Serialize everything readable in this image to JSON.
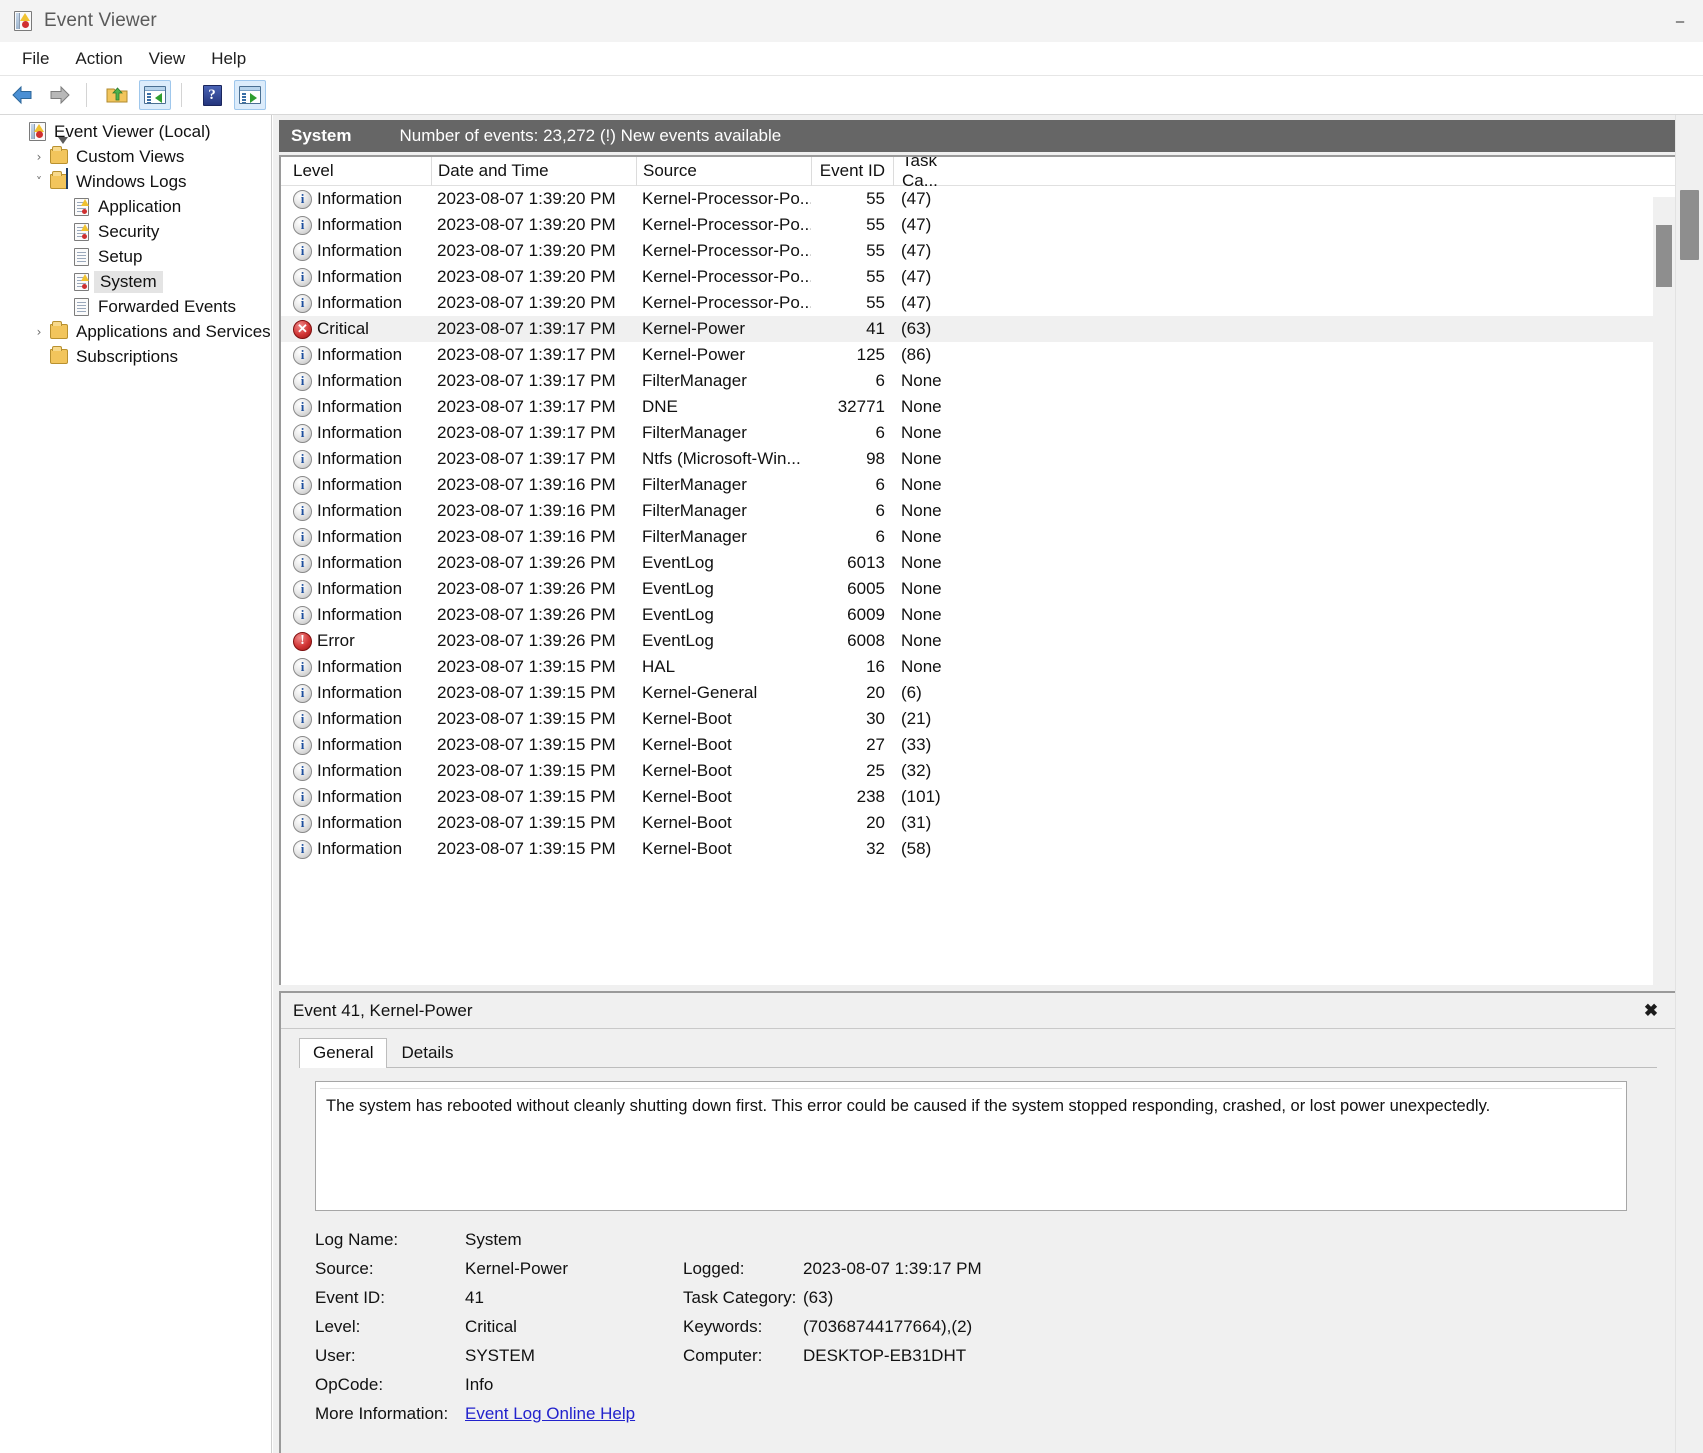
{
  "window": {
    "title": "Event Viewer",
    "icon": "event-viewer-icon",
    "controls": {
      "minimize": "–",
      "maximize": "□",
      "close": "✕"
    }
  },
  "menu": {
    "items": [
      "File",
      "Action",
      "View",
      "Help"
    ]
  },
  "toolbar": {
    "buttons": [
      {
        "name": "back-button",
        "icon": "arrow-left-icon"
      },
      {
        "name": "forward-button",
        "icon": "arrow-right-icon"
      },
      {
        "name": "up-one-level-button",
        "icon": "folder-up-icon"
      },
      {
        "name": "show-hide-console-tree-button",
        "icon": "console-tree-icon",
        "selected": true
      },
      {
        "name": "help-button",
        "icon": "help-question-icon"
      },
      {
        "name": "show-hide-action-pane-button",
        "icon": "action-pane-icon",
        "selected": true
      }
    ]
  },
  "sidebar": {
    "nodes": [
      {
        "label": "Event Viewer (Local)",
        "indent": 0,
        "chevron": "",
        "icon": "event-viewer-icon",
        "selected": false
      },
      {
        "label": "Custom Views",
        "indent": 1,
        "chevron": "›",
        "icon": "folder-filter-icon",
        "selected": false
      },
      {
        "label": "Windows Logs",
        "indent": 1,
        "chevron": "˅",
        "icon": "folder-monitor-icon",
        "selected": false
      },
      {
        "label": "Application",
        "indent": 2,
        "chevron": "",
        "icon": "log-warning-icon",
        "selected": false
      },
      {
        "label": "Security",
        "indent": 2,
        "chevron": "",
        "icon": "log-warning-icon",
        "selected": false
      },
      {
        "label": "Setup",
        "indent": 2,
        "chevron": "",
        "icon": "log-icon",
        "selected": false
      },
      {
        "label": "System",
        "indent": 2,
        "chevron": "",
        "icon": "log-warning-icon",
        "selected": true
      },
      {
        "label": "Forwarded Events",
        "indent": 2,
        "chevron": "",
        "icon": "log-icon",
        "selected": false
      },
      {
        "label": "Applications and Services Log",
        "indent": 1,
        "chevron": "›",
        "icon": "folder-icon",
        "selected": false
      },
      {
        "label": "Subscriptions",
        "indent": 1,
        "chevron": "",
        "icon": "folder-subscription-icon",
        "selected": false
      }
    ]
  },
  "log_header": {
    "name": "System",
    "count_text": "Number of events: 23,272 (!) New events available"
  },
  "table": {
    "columns": [
      "Level",
      "Date and Time",
      "Source",
      "Event ID",
      "Task Ca..."
    ],
    "rows": [
      {
        "level": "Information",
        "level_icon": "info-icon",
        "date": "2023-08-07 1:39:20 PM",
        "source": "Kernel-Processor-Po...",
        "event_id": "55",
        "task": "(47)",
        "selected": false
      },
      {
        "level": "Information",
        "level_icon": "info-icon",
        "date": "2023-08-07 1:39:20 PM",
        "source": "Kernel-Processor-Po...",
        "event_id": "55",
        "task": "(47)",
        "selected": false
      },
      {
        "level": "Information",
        "level_icon": "info-icon",
        "date": "2023-08-07 1:39:20 PM",
        "source": "Kernel-Processor-Po...",
        "event_id": "55",
        "task": "(47)",
        "selected": false
      },
      {
        "level": "Information",
        "level_icon": "info-icon",
        "date": "2023-08-07 1:39:20 PM",
        "source": "Kernel-Processor-Po...",
        "event_id": "55",
        "task": "(47)",
        "selected": false
      },
      {
        "level": "Information",
        "level_icon": "info-icon",
        "date": "2023-08-07 1:39:20 PM",
        "source": "Kernel-Processor-Po...",
        "event_id": "55",
        "task": "(47)",
        "selected": false
      },
      {
        "level": "Critical",
        "level_icon": "critical-icon",
        "date": "2023-08-07 1:39:17 PM",
        "source": "Kernel-Power",
        "event_id": "41",
        "task": "(63)",
        "selected": true
      },
      {
        "level": "Information",
        "level_icon": "info-icon",
        "date": "2023-08-07 1:39:17 PM",
        "source": "Kernel-Power",
        "event_id": "125",
        "task": "(86)",
        "selected": false
      },
      {
        "level": "Information",
        "level_icon": "info-icon",
        "date": "2023-08-07 1:39:17 PM",
        "source": "FilterManager",
        "event_id": "6",
        "task": "None",
        "selected": false
      },
      {
        "level": "Information",
        "level_icon": "info-icon",
        "date": "2023-08-07 1:39:17 PM",
        "source": "DNE",
        "event_id": "32771",
        "task": "None",
        "selected": false
      },
      {
        "level": "Information",
        "level_icon": "info-icon",
        "date": "2023-08-07 1:39:17 PM",
        "source": "FilterManager",
        "event_id": "6",
        "task": "None",
        "selected": false
      },
      {
        "level": "Information",
        "level_icon": "info-icon",
        "date": "2023-08-07 1:39:17 PM",
        "source": "Ntfs (Microsoft-Win...",
        "event_id": "98",
        "task": "None",
        "selected": false
      },
      {
        "level": "Information",
        "level_icon": "info-icon",
        "date": "2023-08-07 1:39:16 PM",
        "source": "FilterManager",
        "event_id": "6",
        "task": "None",
        "selected": false
      },
      {
        "level": "Information",
        "level_icon": "info-icon",
        "date": "2023-08-07 1:39:16 PM",
        "source": "FilterManager",
        "event_id": "6",
        "task": "None",
        "selected": false
      },
      {
        "level": "Information",
        "level_icon": "info-icon",
        "date": "2023-08-07 1:39:16 PM",
        "source": "FilterManager",
        "event_id": "6",
        "task": "None",
        "selected": false
      },
      {
        "level": "Information",
        "level_icon": "info-icon",
        "date": "2023-08-07 1:39:26 PM",
        "source": "EventLog",
        "event_id": "6013",
        "task": "None",
        "selected": false
      },
      {
        "level": "Information",
        "level_icon": "info-icon",
        "date": "2023-08-07 1:39:26 PM",
        "source": "EventLog",
        "event_id": "6005",
        "task": "None",
        "selected": false
      },
      {
        "level": "Information",
        "level_icon": "info-icon",
        "date": "2023-08-07 1:39:26 PM",
        "source": "EventLog",
        "event_id": "6009",
        "task": "None",
        "selected": false
      },
      {
        "level": "Error",
        "level_icon": "error-icon",
        "date": "2023-08-07 1:39:26 PM",
        "source": "EventLog",
        "event_id": "6008",
        "task": "None",
        "selected": false
      },
      {
        "level": "Information",
        "level_icon": "info-icon",
        "date": "2023-08-07 1:39:15 PM",
        "source": "HAL",
        "event_id": "16",
        "task": "None",
        "selected": false
      },
      {
        "level": "Information",
        "level_icon": "info-icon",
        "date": "2023-08-07 1:39:15 PM",
        "source": "Kernel-General",
        "event_id": "20",
        "task": "(6)",
        "selected": false
      },
      {
        "level": "Information",
        "level_icon": "info-icon",
        "date": "2023-08-07 1:39:15 PM",
        "source": "Kernel-Boot",
        "event_id": "30",
        "task": "(21)",
        "selected": false
      },
      {
        "level": "Information",
        "level_icon": "info-icon",
        "date": "2023-08-07 1:39:15 PM",
        "source": "Kernel-Boot",
        "event_id": "27",
        "task": "(33)",
        "selected": false
      },
      {
        "level": "Information",
        "level_icon": "info-icon",
        "date": "2023-08-07 1:39:15 PM",
        "source": "Kernel-Boot",
        "event_id": "25",
        "task": "(32)",
        "selected": false
      },
      {
        "level": "Information",
        "level_icon": "info-icon",
        "date": "2023-08-07 1:39:15 PM",
        "source": "Kernel-Boot",
        "event_id": "238",
        "task": "(101)",
        "selected": false
      },
      {
        "level": "Information",
        "level_icon": "info-icon",
        "date": "2023-08-07 1:39:15 PM",
        "source": "Kernel-Boot",
        "event_id": "20",
        "task": "(31)",
        "selected": false
      },
      {
        "level": "Information",
        "level_icon": "info-icon",
        "date": "2023-08-07 1:39:15 PM",
        "source": "Kernel-Boot",
        "event_id": "32",
        "task": "(58)",
        "selected": false
      }
    ]
  },
  "detail": {
    "title": "Event 41, Kernel-Power",
    "close_glyph": "✖",
    "tabs": [
      {
        "label": "General",
        "active": true
      },
      {
        "label": "Details",
        "active": false
      }
    ],
    "description": "The system has rebooted without cleanly shutting down first. This error could be caused if the system stopped responding, crashed, or lost power unexpectedly.",
    "fields_left": [
      {
        "label": "Log Name:",
        "value": "System"
      },
      {
        "label": "Source:",
        "value": "Kernel-Power"
      },
      {
        "label": "Event ID:",
        "value": "41"
      },
      {
        "label": "Level:",
        "value": "Critical"
      },
      {
        "label": "User:",
        "value": "SYSTEM"
      },
      {
        "label": "OpCode:",
        "value": "Info"
      }
    ],
    "fields_right": [
      {
        "label": "",
        "value": ""
      },
      {
        "label": "Logged:",
        "value": "2023-08-07 1:39:17 PM"
      },
      {
        "label": "Task Category:",
        "value": "(63)"
      },
      {
        "label": "Keywords:",
        "value": "(70368744177664),(2)"
      },
      {
        "label": "Computer:",
        "value": "DESKTOP-EB31DHT"
      },
      {
        "label": "",
        "value": ""
      }
    ],
    "more_info_label": "More Information:",
    "more_info_link": "Event Log Online Help"
  },
  "colors": {
    "header_bar": "#666666",
    "selection": "#f0f0f0",
    "link": "#2222cc",
    "critical": "#d23636",
    "info": "#1d4f9e",
    "toolbar_selected": "#dcecfb"
  }
}
